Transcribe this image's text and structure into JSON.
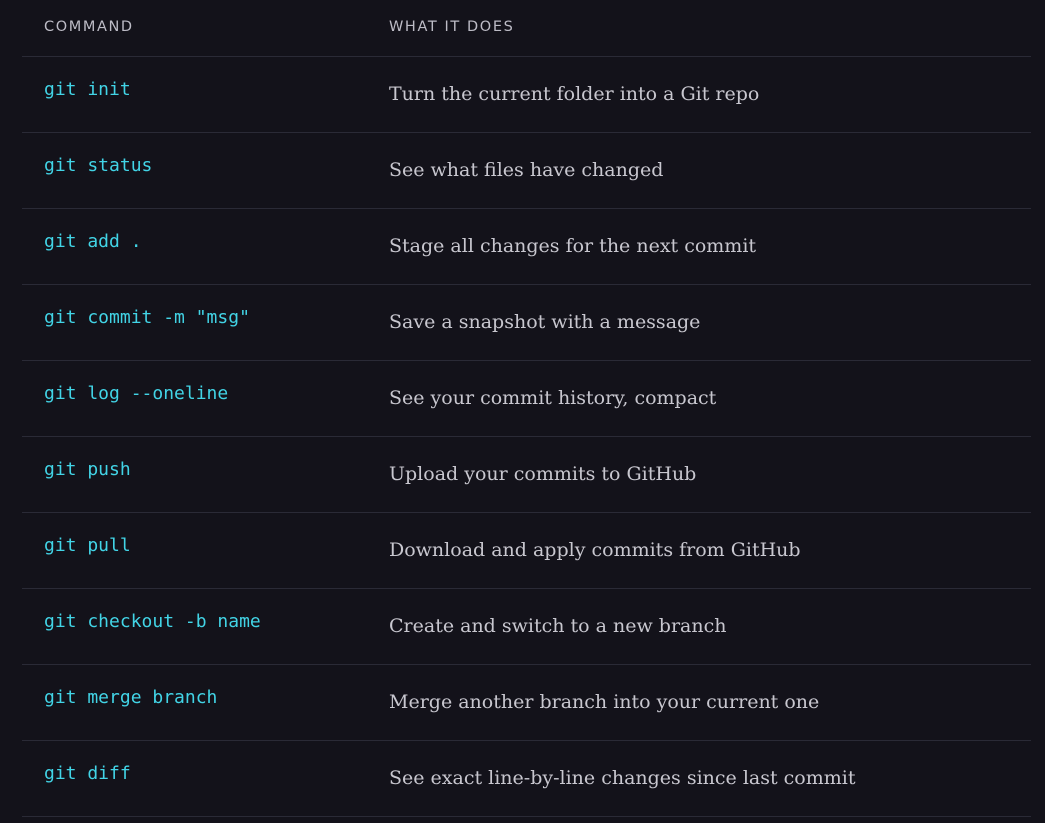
{
  "table": {
    "headers": {
      "command": "COMMAND",
      "description": "WHAT IT DOES"
    },
    "rows": [
      {
        "command": "git init",
        "description": "Turn the current folder into a Git repo"
      },
      {
        "command": "git status",
        "description": "See what files have changed"
      },
      {
        "command": "git add .",
        "description": "Stage all changes for the next commit"
      },
      {
        "command": "git commit -m \"msg\"",
        "description": "Save a snapshot with a message"
      },
      {
        "command": "git log --oneline",
        "description": "See your commit history, compact"
      },
      {
        "command": "git push",
        "description": "Upload your commits to GitHub"
      },
      {
        "command": "git pull",
        "description": "Download and apply commits from GitHub"
      },
      {
        "command": "git checkout -b name",
        "description": "Create and switch to a new branch"
      },
      {
        "command": "git merge branch",
        "description": "Merge another branch into your current one"
      },
      {
        "command": "git diff",
        "description": "See exact line-by-line changes since last commit"
      }
    ]
  },
  "colors": {
    "background": "#13121a",
    "command_text": "#42d4e6",
    "description_text": "#c8c7cf",
    "header_text": "#bdbcc6",
    "divider": "#2a2a36"
  }
}
